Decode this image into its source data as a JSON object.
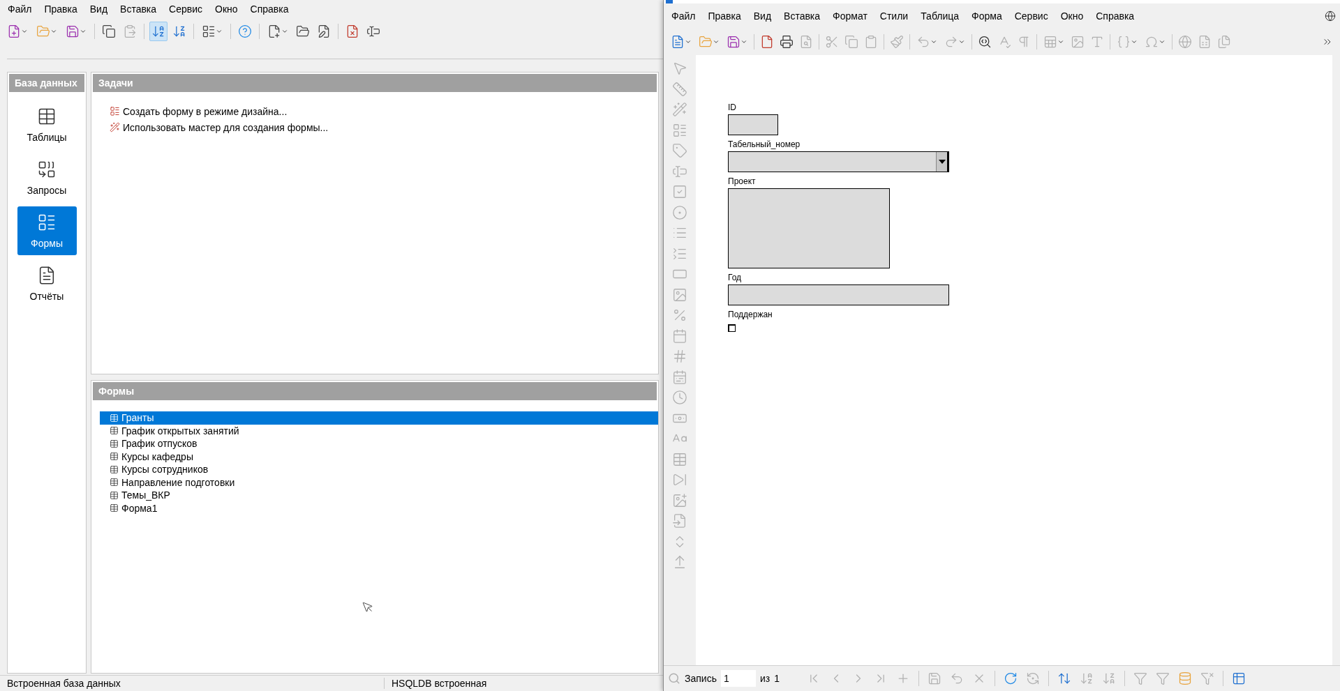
{
  "base_window": {
    "menu": [
      "Файл",
      "Правка",
      "Вид",
      "Вставка",
      "Сервис",
      "Окно",
      "Справка"
    ],
    "sidebar": {
      "title": "База данных",
      "items": [
        {
          "label": "Таблицы",
          "kind": "tables",
          "selected": false
        },
        {
          "label": "Запросы",
          "kind": "queries",
          "selected": false
        },
        {
          "label": "Формы",
          "kind": "forms",
          "selected": true
        },
        {
          "label": "Отчёты",
          "kind": "reports",
          "selected": false
        }
      ]
    },
    "tasks": {
      "title": "Задачи",
      "items": [
        {
          "label": "Создать форму в режиме дизайна...",
          "kind": "design"
        },
        {
          "label": "Использовать мастер для создания формы...",
          "kind": "wizard"
        }
      ]
    },
    "forms": {
      "title": "Формы",
      "items": [
        {
          "label": "Гранты",
          "selected": true
        },
        {
          "label": "График открытых занятий",
          "selected": false
        },
        {
          "label": "График отпусков",
          "selected": false
        },
        {
          "label": "Курсы кафедры",
          "selected": false
        },
        {
          "label": "Курсы сотрудников",
          "selected": false
        },
        {
          "label": "Направление подготовки",
          "selected": false
        },
        {
          "label": "Темы_ВКР",
          "selected": false
        },
        {
          "label": "Форма1",
          "selected": false
        }
      ]
    },
    "status_bar": [
      "Встроенная база данных",
      "HSQLDB встроенная"
    ]
  },
  "form_window": {
    "menu": [
      "Файл",
      "Правка",
      "Вид",
      "Вставка",
      "Формат",
      "Стили",
      "Таблица",
      "Форма",
      "Сервис",
      "Окно",
      "Справка"
    ],
    "fields": [
      {
        "kind": "narrow",
        "label": "ID"
      },
      {
        "kind": "combo",
        "label": "Табельный_номер"
      },
      {
        "kind": "memo",
        "label": "Проект"
      },
      {
        "kind": "wide",
        "label": "Год"
      },
      {
        "kind": "checkbox",
        "label": "Поддержан",
        "checked": false
      }
    ],
    "navigation": {
      "label": "Запись",
      "value": "1",
      "of": "из",
      "total": "1"
    }
  }
}
